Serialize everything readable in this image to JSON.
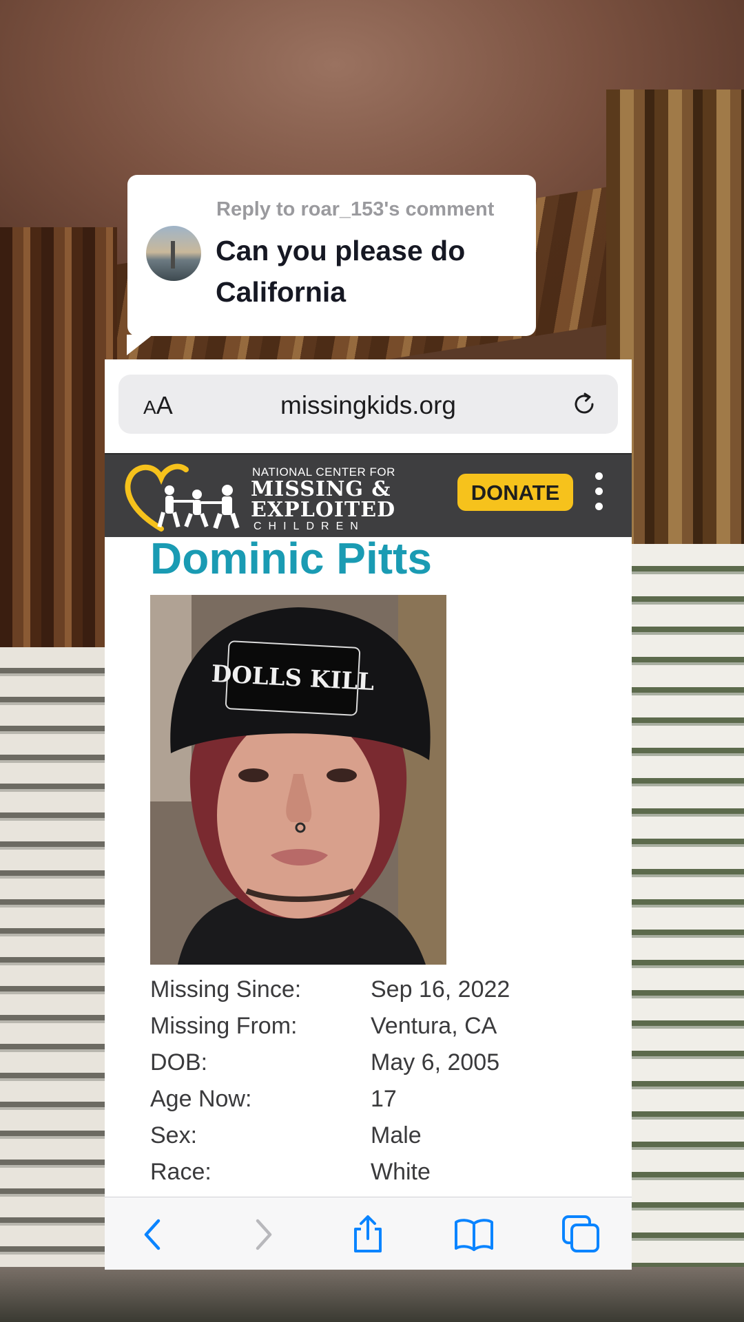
{
  "reply": {
    "label": "Reply to roar_153's comment",
    "text": "Can you please do California"
  },
  "browser": {
    "aa_large": "A",
    "aa_small": "A",
    "url": "missingkids.org"
  },
  "site": {
    "logo_line1": "NATIONAL CENTER FOR",
    "logo_line2": "MISSING &",
    "logo_line3": "EXPLOITED",
    "logo_line4": "CHILDREN",
    "donate_label": "DONATE"
  },
  "poster": {
    "name": "Dominic Pitts",
    "beanie_text": "DOLLS KILL",
    "details": [
      {
        "label": "Missing Since:",
        "value": "Sep 16, 2022"
      },
      {
        "label": "Missing From:",
        "value": "Ventura, CA"
      },
      {
        "label": "DOB:",
        "value": "May 6, 2005"
      },
      {
        "label": "Age Now:",
        "value": "17"
      },
      {
        "label": "Sex:",
        "value": "Male"
      },
      {
        "label": "Race:",
        "value": "White"
      }
    ]
  },
  "toolbar": {
    "icons": [
      "back-icon",
      "forward-icon",
      "share-icon",
      "bookmarks-icon",
      "tabs-icon"
    ]
  },
  "colors": {
    "name_teal": "#1a9bb3",
    "donate_yellow": "#f6c21c",
    "header_gray": "#3e3e40",
    "ios_blue": "#0a84ff"
  }
}
